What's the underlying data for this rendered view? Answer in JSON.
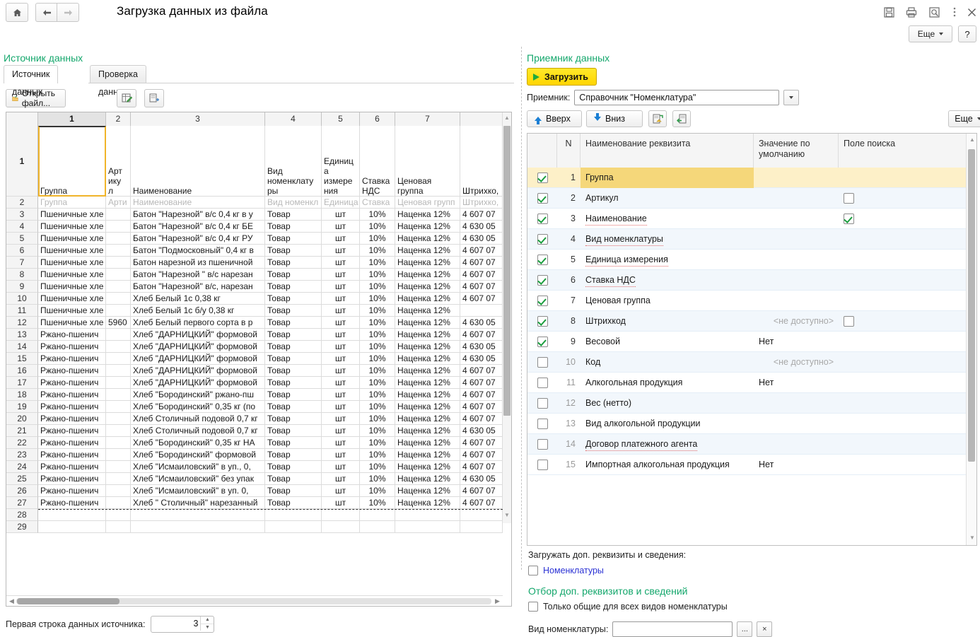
{
  "window": {
    "title": "Загрузка данных из файла",
    "nav": {
      "home": "⌂",
      "back": "←",
      "forward": "→"
    },
    "icons": {
      "save": "save-icon",
      "print": "print-icon",
      "preview": "print-preview-icon",
      "menu": "more-menu-icon",
      "close": "×"
    },
    "more_button": "Еще",
    "help_button": "?"
  },
  "source": {
    "section_title": "Источник данных",
    "tabs": [
      {
        "label": "Источник данных",
        "active": true
      },
      {
        "label": "Проверка данных",
        "active": false
      }
    ],
    "toolbar": {
      "open_file": "Открыть файл...",
      "edit_icon": "edit-table-icon",
      "insert_icon": "insert-row-icon"
    },
    "column_headers": [
      "1",
      "2",
      "3",
      "4",
      "5",
      "6",
      "7",
      ""
    ],
    "selected_column": "1",
    "header_row": {
      "n": "1",
      "cells": [
        "Группа",
        "Арт\nику\nл",
        "Наименование",
        "Вид\nноменклату\nры",
        "Единиц\nа\nизмере\nния",
        "Ставка\nНДС",
        "Ценовая\nгруппа",
        "Штрихко,"
      ]
    },
    "template_row": {
      "n": "2",
      "cells": [
        "Группа",
        "Арти",
        "Наименование",
        "Вид номенкл",
        "Единица",
        "Ставка ",
        "Ценовая групп",
        "Штрихко,"
      ]
    },
    "rows": [
      {
        "n": "3",
        "c1": "Пшеничные хле",
        "c2": "",
        "c3": "Батон \"Нарезной\" в/с 0,4 кг в у",
        "c4": "Товар",
        "c5": "шт",
        "c6": "10%",
        "c7": "Наценка 12%",
        "c8": "4 607 07"
      },
      {
        "n": "4",
        "c1": "Пшеничные хле",
        "c2": "",
        "c3": "Батон \"Нарезной\" в/с 0,4 кг БЕ",
        "c4": "Товар",
        "c5": "шт",
        "c6": "10%",
        "c7": "Наценка 12%",
        "c8": "4 630 05"
      },
      {
        "n": "5",
        "c1": "Пшеничные хле",
        "c2": "",
        "c3": "Батон \"Нарезной\" в/с 0,4 кг РУ",
        "c4": "Товар",
        "c5": "шт",
        "c6": "10%",
        "c7": "Наценка 12%",
        "c8": "4 630 05"
      },
      {
        "n": "6",
        "c1": "Пшеничные хле",
        "c2": "",
        "c3": "Батон \"Подмосковный\" 0,4 кг в",
        "c4": "Товар",
        "c5": "шт",
        "c6": "10%",
        "c7": "Наценка 12%",
        "c8": "4 607 07"
      },
      {
        "n": "7",
        "c1": "Пшеничные хле",
        "c2": "",
        "c3": "Батон нарезной из пшеничной",
        "c4": "Товар",
        "c5": "шт",
        "c6": "10%",
        "c7": "Наценка 12%",
        "c8": "4 607 07"
      },
      {
        "n": "8",
        "c1": "Пшеничные хле",
        "c2": "",
        "c3": "Батон \"Нарезной \"  в/с нарезан",
        "c4": "Товар",
        "c5": "шт",
        "c6": "10%",
        "c7": "Наценка 12%",
        "c8": "4 607 07"
      },
      {
        "n": "9",
        "c1": "Пшеничные хле",
        "c2": "",
        "c3": "Батон \"Нарезной\" в/с, нарезан",
        "c4": "Товар",
        "c5": "шт",
        "c6": "10%",
        "c7": "Наценка 12%",
        "c8": "4 607 07"
      },
      {
        "n": "10",
        "c1": "Пшеничные хле",
        "c2": "",
        "c3": "Хлеб Белый 1с 0,38 кг",
        "c4": "Товар",
        "c5": "шт",
        "c6": "10%",
        "c7": "Наценка 12%",
        "c8": "4 607 07"
      },
      {
        "n": "11",
        "c1": "Пшеничные хле",
        "c2": "",
        "c3": "Хлеб Белый 1с б/у 0,38 кг",
        "c4": "Товар",
        "c5": "шт",
        "c6": "10%",
        "c7": "Наценка 12%",
        "c8": ""
      },
      {
        "n": "12",
        "c1": "Пшеничные хле",
        "c2": "5960",
        "c3": "Хлеб Белый  первого сорта в р",
        "c4": "Товар",
        "c5": "шт",
        "c6": "10%",
        "c7": "Наценка 12%",
        "c8": "4 630 05"
      },
      {
        "n": "13",
        "c1": "Ржано-пшенич",
        "c2": "",
        "c3": "Хлеб \"ДАРНИЦКИЙ\" формовой",
        "c4": "Товар",
        "c5": "шт",
        "c6": "10%",
        "c7": "Наценка 12%",
        "c8": "4 607 07"
      },
      {
        "n": "14",
        "c1": "Ржано-пшенич",
        "c2": "",
        "c3": "Хлеб \"ДАРНИЦКИЙ\" формовой",
        "c4": "Товар",
        "c5": "шт",
        "c6": "10%",
        "c7": "Наценка 12%",
        "c8": "4 630 05"
      },
      {
        "n": "15",
        "c1": "Ржано-пшенич",
        "c2": "",
        "c3": "Хлеб \"ДАРНИЦКИЙ\" формовой",
        "c4": "Товар",
        "c5": "шт",
        "c6": "10%",
        "c7": "Наценка 12%",
        "c8": "4 630 05"
      },
      {
        "n": "16",
        "c1": "Ржано-пшенич",
        "c2": "",
        "c3": "Хлеб \"ДАРНИЦКИЙ\" формовой",
        "c4": "Товар",
        "c5": "шт",
        "c6": "10%",
        "c7": "Наценка 12%",
        "c8": "4 607 07"
      },
      {
        "n": "17",
        "c1": "Ржано-пшенич",
        "c2": "",
        "c3": "Хлеб \"ДАРНИЦКИЙ\" формовой",
        "c4": "Товар",
        "c5": "шт",
        "c6": "10%",
        "c7": "Наценка 12%",
        "c8": "4 607 07"
      },
      {
        "n": "18",
        "c1": "Ржано-пшенич",
        "c2": "",
        "c3": "Хлеб \"Бородинский\" ржано-пш",
        "c4": "Товар",
        "c5": "шт",
        "c6": "10%",
        "c7": "Наценка 12%",
        "c8": "4 607 07"
      },
      {
        "n": "19",
        "c1": "Ржано-пшенич",
        "c2": "",
        "c3": "Хлеб \"Бородинский\" 0,35 кг (по",
        "c4": "Товар",
        "c5": "шт",
        "c6": "10%",
        "c7": "Наценка 12%",
        "c8": "4 607 07"
      },
      {
        "n": "20",
        "c1": "Ржано-пшенич",
        "c2": "",
        "c3": "Хлеб Столичный подовой 0,7 кг",
        "c4": "Товар",
        "c5": "шт",
        "c6": "10%",
        "c7": "Наценка 12%",
        "c8": "4 607 07"
      },
      {
        "n": "21",
        "c1": "Ржано-пшенич",
        "c2": "",
        "c3": "Хлеб Столичный подовой 0,7 кг",
        "c4": "Товар",
        "c5": "шт",
        "c6": "10%",
        "c7": "Наценка 12%",
        "c8": "4 630 05"
      },
      {
        "n": "22",
        "c1": "Ржано-пшенич",
        "c2": "",
        "c3": "Хлеб \"Бородинский\" 0,35 кг НА",
        "c4": "Товар",
        "c5": "шт",
        "c6": "10%",
        "c7": "Наценка 12%",
        "c8": "4 607 07"
      },
      {
        "n": "23",
        "c1": "Ржано-пшенич",
        "c2": "",
        "c3": "Хлеб \"Бородинский\" формовой",
        "c4": "Товар",
        "c5": "шт",
        "c6": "10%",
        "c7": "Наценка 12%",
        "c8": "4 607 07"
      },
      {
        "n": "24",
        "c1": "Ржано-пшенич",
        "c2": "",
        "c3": "Хлеб \"Исмаиловский\"  в уп., 0,",
        "c4": "Товар",
        "c5": "шт",
        "c6": "10%",
        "c7": "Наценка 12%",
        "c8": "4 607 07"
      },
      {
        "n": "25",
        "c1": "Ржано-пшенич",
        "c2": "",
        "c3": "Хлеб \"Исмаиловский\"  без упак",
        "c4": "Товар",
        "c5": "шт",
        "c6": "10%",
        "c7": "Наценка 12%",
        "c8": "4 630 05"
      },
      {
        "n": "26",
        "c1": "Ржано-пшенич",
        "c2": "",
        "c3": "Хлеб \"Исмаиловский\"  в уп.  0,",
        "c4": "Товар",
        "c5": "шт",
        "c6": "10%",
        "c7": "Наценка 12%",
        "c8": "4 607 07"
      },
      {
        "n": "27",
        "c1": "Ржано-пшенич",
        "c2": "",
        "c3": "Хлеб \" Столичный\" нарезанный",
        "c4": "Товар",
        "c5": "шт",
        "c6": "10%",
        "c7": "Наценка 12%",
        "c8": "4 607 07"
      },
      {
        "n": "28",
        "c1": "",
        "c2": "",
        "c3": "",
        "c4": "",
        "c5": "",
        "c6": "",
        "c7": "",
        "c8": ""
      },
      {
        "n": "29",
        "c1": "",
        "c2": "",
        "c3": "",
        "c4": "",
        "c5": "",
        "c6": "",
        "c7": "",
        "c8": ""
      }
    ],
    "first_row_label": "Первая строка данных источника:",
    "first_row_value": "3"
  },
  "receiver": {
    "section_title": "Приемник данных",
    "load_button": "Загрузить",
    "receiver_label": "Приемник:",
    "receiver_value": "Справочник \"Номенклатура\"",
    "toolbar": {
      "up": "Вверх",
      "down": "Вниз",
      "fill_icon": "fill-values-icon",
      "load_icon": "load-values-icon",
      "more": "Еще"
    },
    "columns": [
      "",
      "N",
      "Наименование реквизита",
      "Значение по умолчанию",
      "Поле поиска"
    ],
    "rows": [
      {
        "n": "1",
        "checked": true,
        "name": "Группа",
        "default": "",
        "search": null,
        "selected": true,
        "squiggle": false,
        "dim": false
      },
      {
        "n": "2",
        "checked": true,
        "name": "Артикул",
        "default": "",
        "search": false,
        "selected": false,
        "squiggle": false,
        "dim": false
      },
      {
        "n": "3",
        "checked": true,
        "name": "Наименование",
        "default": "",
        "search": true,
        "selected": false,
        "squiggle": true,
        "dim": false
      },
      {
        "n": "4",
        "checked": true,
        "name": "Вид номенклатуры",
        "default": "",
        "search": null,
        "selected": false,
        "squiggle": true,
        "dim": false
      },
      {
        "n": "5",
        "checked": true,
        "name": "Единица измерения",
        "default": "",
        "search": null,
        "selected": false,
        "squiggle": true,
        "dim": false
      },
      {
        "n": "6",
        "checked": true,
        "name": "Ставка НДС",
        "default": "",
        "search": null,
        "selected": false,
        "squiggle": true,
        "dim": false
      },
      {
        "n": "7",
        "checked": true,
        "name": "Ценовая группа",
        "default": "",
        "search": null,
        "selected": false,
        "squiggle": false,
        "dim": false
      },
      {
        "n": "8",
        "checked": true,
        "name": "Штрихкод",
        "default": "<не доступно>",
        "search": false,
        "selected": false,
        "squiggle": false,
        "dim": true
      },
      {
        "n": "9",
        "checked": true,
        "name": "Весовой",
        "default": "Нет",
        "search": null,
        "selected": false,
        "squiggle": false,
        "dim": false
      },
      {
        "n": "10",
        "checked": false,
        "name": "Код",
        "default": "<не доступно>",
        "search": null,
        "selected": false,
        "squiggle": false,
        "dim": true
      },
      {
        "n": "11",
        "checked": false,
        "name": "Алкогольная продукция",
        "default": "Нет",
        "search": null,
        "selected": false,
        "squiggle": false,
        "dim": false
      },
      {
        "n": "12",
        "checked": false,
        "name": "Вес (нетто)",
        "default": "",
        "search": null,
        "selected": false,
        "squiggle": false,
        "dim": false
      },
      {
        "n": "13",
        "checked": false,
        "name": "Вид алкогольной продукции",
        "default": "",
        "search": null,
        "selected": false,
        "squiggle": false,
        "dim": false
      },
      {
        "n": "14",
        "checked": false,
        "name": "Договор платежного агента",
        "default": "",
        "search": null,
        "selected": false,
        "squiggle": true,
        "dim": false
      },
      {
        "n": "15",
        "checked": false,
        "name": "Импортная алкогольная продукция",
        "default": "Нет",
        "search": null,
        "selected": false,
        "squiggle": false,
        "dim": false
      }
    ],
    "bottom": {
      "extra_label": "Загружать доп. реквизиты и сведения:",
      "nomenclature_link": "Номенклатуры",
      "filter_title": "Отбор доп. реквизитов и сведений",
      "only_common_label": "Только общие для всех видов номенклатуры",
      "kind_label": "Вид номенклатуры:",
      "kind_value": "",
      "pick_button": "...",
      "clear_button": "×"
    }
  },
  "colors": {
    "accent_green": "#14a76c",
    "load_yellow": "#ffd500",
    "selected_row": "#fdf0c8",
    "alt_row": "#f2f7fc",
    "link_blue": "#2b32d4",
    "check_green": "#1c9e3f"
  }
}
